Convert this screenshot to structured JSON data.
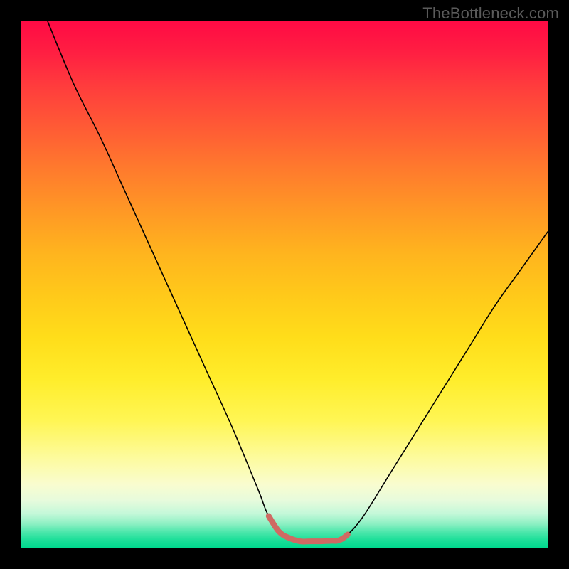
{
  "watermark": "TheBottleneck.com",
  "chart_data": {
    "type": "line",
    "title": "",
    "xlabel": "",
    "ylabel": "",
    "xlim": [
      0,
      100
    ],
    "ylim": [
      0,
      100
    ],
    "grid": false,
    "legend": false,
    "series": [
      {
        "name": "bottleneck-curve",
        "color": "#000000",
        "stroke_width": 1.6,
        "x": [
          5,
          10,
          15,
          20,
          25,
          30,
          35,
          40,
          45,
          47,
          50,
          53,
          57,
          60,
          62,
          65,
          70,
          75,
          80,
          85,
          90,
          95,
          100
        ],
        "values": [
          100,
          88,
          78,
          67,
          56,
          45,
          34,
          23,
          11,
          6,
          2,
          1.2,
          1.2,
          1.3,
          2.5,
          6,
          14,
          22,
          30,
          38,
          46,
          53,
          60
        ]
      }
    ],
    "highlight": {
      "name": "optimal-range",
      "color": "#cf6a63",
      "stroke_width": 8,
      "x": [
        47,
        49,
        51,
        53,
        55,
        57,
        59,
        60,
        61,
        62
      ],
      "values": [
        6,
        3,
        1.8,
        1.2,
        1.2,
        1.2,
        1.3,
        1.3,
        1.7,
        2.5
      ]
    }
  }
}
